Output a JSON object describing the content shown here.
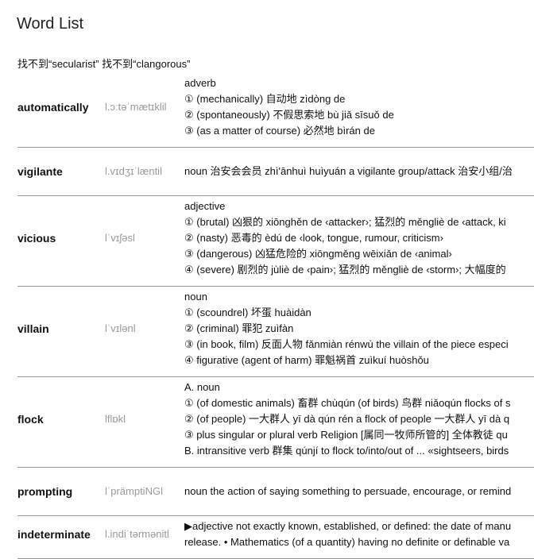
{
  "title": "Word List",
  "not_found": "找不到“secularist” 找不到“clangorous”",
  "entries": [
    {
      "word": "automatically",
      "phonetic": "l.ɔːtəˈmætɪklil",
      "lines": [
        "adverb",
        "① (mechanically) 自动地 zìdòng de",
        "② (spontaneously) 不假思索地 bù jiǎ sīsuǒ de",
        "③ (as a matter of course) 必然地 bìrán de"
      ]
    },
    {
      "word": "vigilante",
      "phonetic": "l.vɪdʒɪˈlæntil",
      "lines": [
        "noun 治安会会员 zhì'ānhuì huìyuán a vigilante group/attack 治安小组/治"
      ]
    },
    {
      "word": "vicious",
      "phonetic": "lˈvɪʃəsl",
      "lines": [
        "adjective",
        "① (brutal) 凶狠的 xiōnghěn de ‹attacker›; 猛烈的 měngliè de ‹attack, ki",
        "② (nasty) 恶毒的 èdú de ‹look, tongue, rumour, criticism›",
        "③ (dangerous) 凶猛危险的 xiōngměng wēixiǎn de ‹animal›",
        "④ (severe) 剧烈的 jùliè de ‹pain›; 猛烈的 měngliè de ‹storm›; 大幅度的"
      ]
    },
    {
      "word": "villain",
      "phonetic": "lˈvɪlənl",
      "lines": [
        "noun",
        "① (scoundrel) 坏蛋 huàidàn",
        "② (criminal) 罪犯 zuìfàn",
        "③ (in book, film) 反面人物 fǎnmiàn rénwù the villain of the piece especi",
        "④ figurative (agent of harm) 罪魁祸首 zuìkuí huòshǒu"
      ]
    },
    {
      "word": "flock",
      "phonetic": "lflɒkl",
      "lines": [
        "A. noun",
        "① (of domestic animals) 畜群 chùqún (of birds) 鸟群 niǎoqún flocks of s",
        "② (of people) 一大群人 yī dà qún rén a flock of people 一大群人 yī dà q",
        "③ plus singular or plural verb Religion [属同一牧师所管的] 全体教徒 qu",
        "B. intransitive verb 群集 qúnjí to flock to/into/out of ... «sightseers, birds"
      ]
    },
    {
      "word": "prompting",
      "phonetic": "lˈprämptiNGl",
      "lines": [
        "noun the action of saying something to persuade, encourage, or remind"
      ]
    },
    {
      "word": "indeterminate",
      "phonetic": "l.indiˈtərmənitl",
      "lines": [
        "▶adjective not exactly known, established, or defined: the date of manu",
        "release. • Mathematics (of a quantity) having no definite or definable va"
      ]
    }
  ]
}
